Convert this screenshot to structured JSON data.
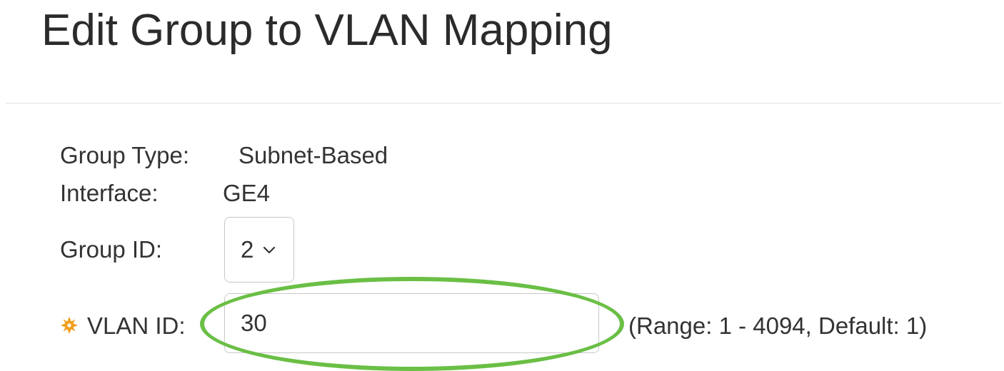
{
  "page": {
    "title": "Edit Group to VLAN Mapping"
  },
  "form": {
    "group_type": {
      "label": "Group Type:",
      "value": "Subnet-Based"
    },
    "interface": {
      "label": "Interface:",
      "value": "GE4"
    },
    "group_id": {
      "label": "Group ID:",
      "selected": "2"
    },
    "vlan_id": {
      "label": "VLAN ID:",
      "value": "30",
      "hint": "(Range: 1 - 4094, Default: 1)",
      "required": true
    }
  },
  "colors": {
    "highlight": "#6abf45",
    "required_icon": "#f0a020"
  },
  "icons": {
    "required": "required-asterisk-icon",
    "dropdown": "chevron-down-icon"
  }
}
